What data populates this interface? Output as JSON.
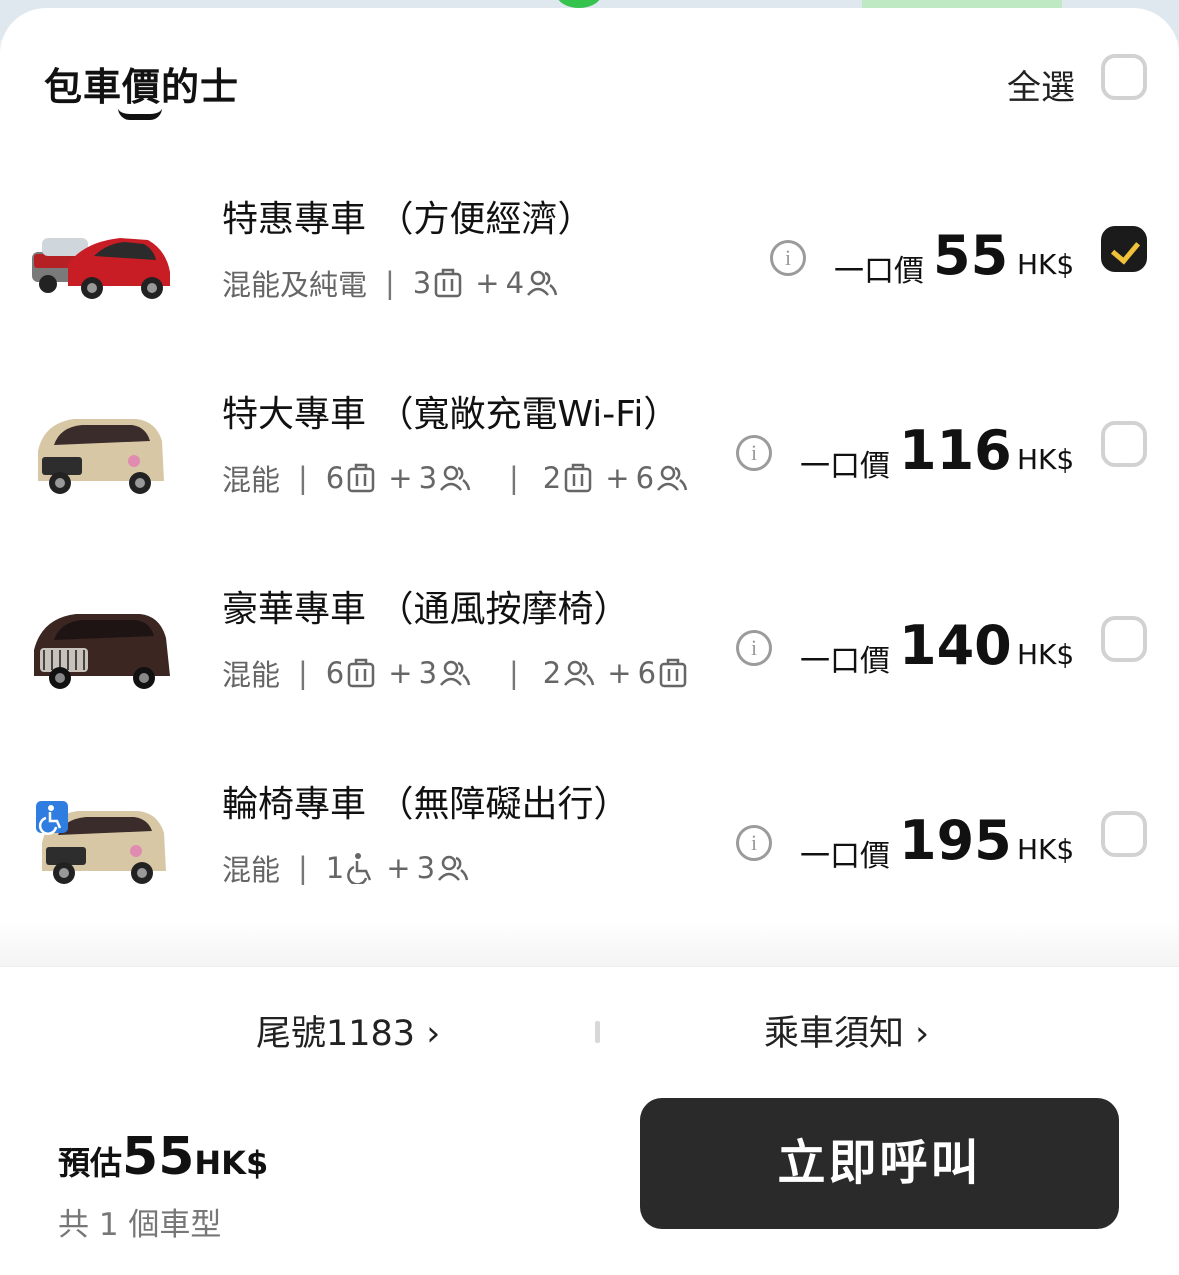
{
  "header": {
    "tab_title": "包車價的士",
    "select_all_label": "全選",
    "select_all_checked": false
  },
  "rows": [
    {
      "title": "特惠專車 （方便經濟）",
      "power": "混能及純電",
      "spec_a": {
        "luggage": "3",
        "passengers": "4"
      },
      "price_label": "一口價",
      "price": "55",
      "currency": "HK$",
      "checked": true
    },
    {
      "title": " 特大專車 （寬敞充電Wi-Fi）",
      "power": "混能",
      "spec_a": {
        "luggage": "6",
        "passengers": "3"
      },
      "spec_b": {
        "first": "2",
        "second": "6"
      },
      "price_label": "一口價",
      "price": "116",
      "currency": "HK$",
      "checked": false
    },
    {
      "title": "豪華專車 （通風按摩椅）",
      "power": "混能",
      "spec_a": {
        "luggage": "6",
        "passengers": "3"
      },
      "spec_b": {
        "first": "2",
        "second": "6"
      },
      "price_label": "一口價",
      "price": "140",
      "currency": "HK$",
      "checked": false
    },
    {
      "title": "輪椅專車 （無障礙出行）",
      "power": "混能",
      "spec_a": {
        "wheelchair": "1",
        "passengers": "3"
      },
      "price_label": "一口價",
      "price": "195",
      "currency": "HK$",
      "checked": false
    }
  ],
  "footer": {
    "plate_link": "尾號1183 ›",
    "notice_link": "乘車須知 ›",
    "estimate_label": "預估",
    "estimate_value": "55",
    "estimate_unit": "HK$",
    "vehicle_count": "共 1 個車型",
    "call_button": "立即呼叫"
  },
  "colors": {
    "accent_check": "#f2c13a",
    "button_bg": "#2a2a2a",
    "wheelchair_badge": "#2f7de1"
  },
  "icons": [
    "info-icon",
    "luggage-icon",
    "passengers-icon",
    "wheelchair-icon",
    "check-icon"
  ]
}
